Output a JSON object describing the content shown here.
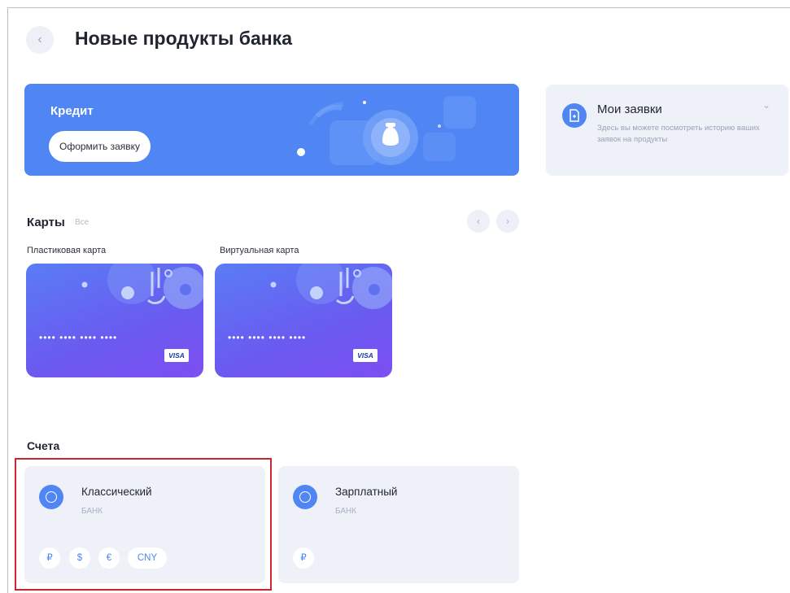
{
  "header": {
    "back_icon": "‹",
    "title": "Новые продукты банка"
  },
  "credit_banner": {
    "title": "Кредит",
    "button_label": "Оформить заявку",
    "color": "#4f86f4"
  },
  "requests": {
    "title": "Мои заявки",
    "description": "Здесь вы можете посмотреть историю ваших заявок на продукты",
    "chevron": "⌄"
  },
  "cards_section": {
    "title": "Карты",
    "filter": "Все",
    "prev_icon": "‹",
    "next_icon": "›",
    "cards": [
      {
        "label": "Пластиковая карта",
        "number_mask": "••••  ••••  ••••  ••••",
        "brand": "VISA"
      },
      {
        "label": "Виртуальная карта",
        "number_mask": "••••  ••••  ••••  ••••",
        "brand": "VISA"
      }
    ]
  },
  "accounts_section": {
    "title": "Счета",
    "accounts": [
      {
        "name": "Классический",
        "subtitle": "БАНК",
        "currencies": [
          "₽",
          "$",
          "€",
          "CNY"
        ]
      },
      {
        "name": "Зарплатный",
        "subtitle": "БАНК",
        "currencies": [
          "₽"
        ]
      }
    ]
  },
  "colors": {
    "accent": "#4f86f4",
    "highlight": "#c8262a"
  }
}
